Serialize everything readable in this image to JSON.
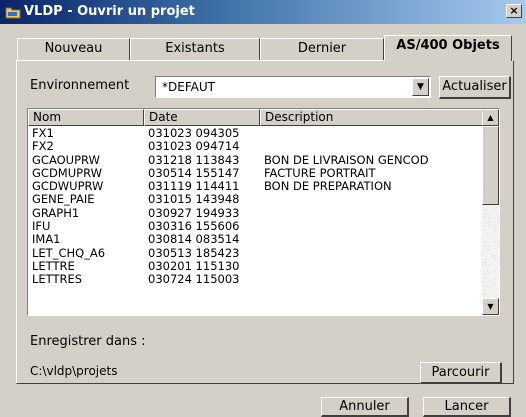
{
  "window": {
    "title": "VLDP - Ouvrir un  projet",
    "close_glyph": "×"
  },
  "tabs": [
    {
      "label": "Nouveau"
    },
    {
      "label": "Existants"
    },
    {
      "label": "Dernier"
    },
    {
      "label": "AS/400 Objets",
      "active": true
    }
  ],
  "environment": {
    "label": "Environnement",
    "value": "*DEFAUT",
    "refresh_label": "Actualiser"
  },
  "list": {
    "columns": [
      "Nom",
      "Date",
      "Description"
    ],
    "rows": [
      {
        "nom": "FX1",
        "date": "031023 094305",
        "description": ""
      },
      {
        "nom": "FX2",
        "date": "031023 094714",
        "description": ""
      },
      {
        "nom": "GCAOUPRW",
        "date": "031218 113843",
        "description": "BON DE LIVRAISON GENCOD"
      },
      {
        "nom": "GCDMUPRW",
        "date": "030514 155147",
        "description": "FACTURE PORTRAIT"
      },
      {
        "nom": "GCDWUPRW",
        "date": "031119 114411",
        "description": "BON DE PREPARATION"
      },
      {
        "nom": "GENE_PAIE",
        "date": "031015 143948",
        "description": ""
      },
      {
        "nom": "GRAPH1",
        "date": "030927 194933",
        "description": ""
      },
      {
        "nom": "IFU",
        "date": "030316 155606",
        "description": ""
      },
      {
        "nom": "IMA1",
        "date": "030814 083514",
        "description": ""
      },
      {
        "nom": "LET_CHQ_A6",
        "date": "030513 185423",
        "description": ""
      },
      {
        "nom": "LETTRE",
        "date": "030201 115130",
        "description": ""
      },
      {
        "nom": "LETTRES",
        "date": "030724 115003",
        "description": ""
      }
    ]
  },
  "save": {
    "label": "Enregistrer dans :",
    "path": "C:\\vldp\\projets",
    "browse_label": "Parcourir"
  },
  "footer": {
    "cancel_label": "Annuler",
    "launch_label": "Lancer"
  },
  "icons": {
    "app": "folder-icon",
    "scroll_up": "up-arrow-icon",
    "scroll_down": "down-arrow-icon",
    "combo": "dropdown-arrow-icon"
  }
}
